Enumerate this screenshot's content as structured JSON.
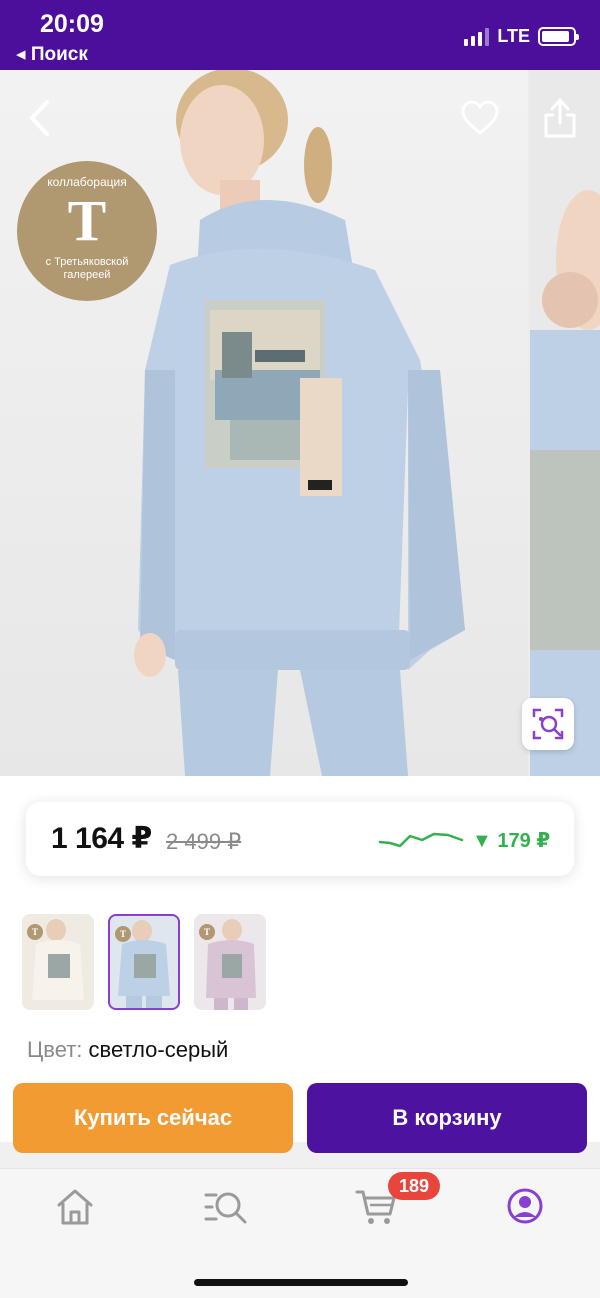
{
  "status_bar": {
    "time": "20:09",
    "back_label": "◂ Поиск",
    "network": "LTE",
    "background": "#4b0f9c"
  },
  "product_image": {
    "description_icons": [
      "back-chevron-icon",
      "heart-icon",
      "share-icon",
      "visual-search-icon"
    ],
    "collab_badge": {
      "top_text": "коллаборация",
      "logo_letter": "T",
      "bottom_text": "с Третьяковской галереей"
    }
  },
  "price": {
    "current": "1 164 ₽",
    "old": "2 499 ₽",
    "drop": "▼ 179 ₽",
    "drop_color": "#35b04f"
  },
  "swatches": [
    {
      "color": "#efebe3",
      "selected": false
    },
    {
      "color": "#bcd0e6",
      "selected": true
    },
    {
      "color": "#d9c4d6",
      "selected": false
    }
  ],
  "color_selection": {
    "label": "Цвет:",
    "value": "светло-серый"
  },
  "actions": {
    "buy_now": "Купить сейчас",
    "add_to_cart": "В корзину",
    "buy_color": "#f39b33",
    "cart_color": "#4e12a0"
  },
  "bottom_nav": {
    "items": [
      "home-icon",
      "catalog-search-icon",
      "cart-icon",
      "profile-icon"
    ],
    "cart_count": "189",
    "active_color": "#8a3fd0"
  }
}
